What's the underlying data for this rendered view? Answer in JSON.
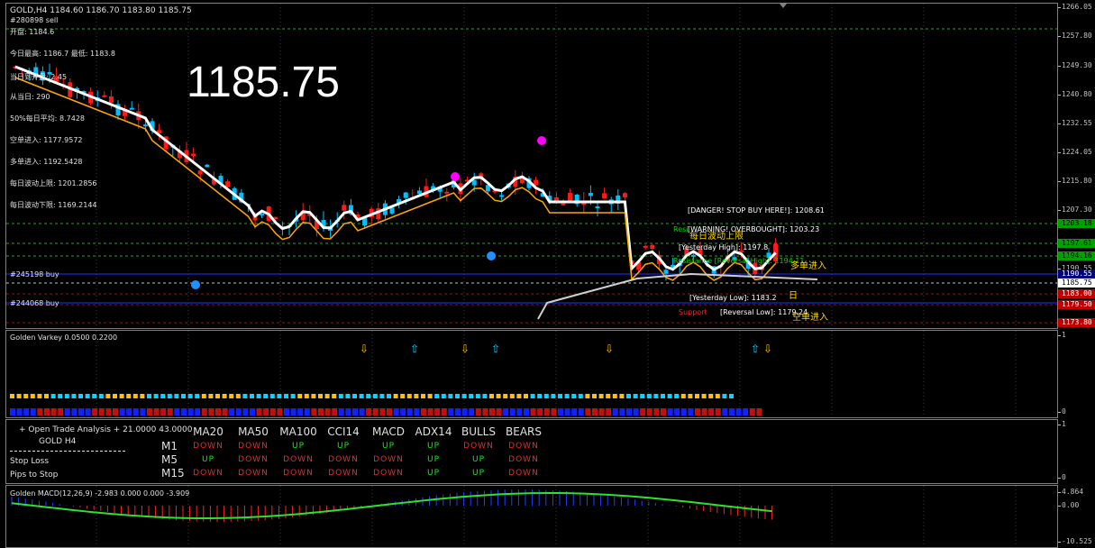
{
  "main": {
    "title": "GOLD,H4  1184.60 1186.70 1183.80 1185.75",
    "big_price": "1185.75",
    "info_lines": [
      "#280898 sell",
      "开盘: 1184.6",
      "今日最高: 1186.7  最低: 1183.8",
      "当日到开盘: 2.45",
      "从当日: 290",
      "50%每日平均: 8.7428",
      "空单进入: 1177.9572",
      "多单进入: 1192.5428",
      "每日波动上限: 1201.2856",
      "每日波动下限: 1169.2144"
    ],
    "order_labels": [
      "#245198 buy",
      "#244068 buy"
    ],
    "levels": {
      "danger": "[DANGER! STOP BUY HERE!]: 1208.61",
      "overbought": "[WARNING! OVERBOUGHT]: 1203.23",
      "upper_band": "每日波动上限",
      "yesterday_high": "[Yesterday High]: 1197.8",
      "resistance": "Resistance [Reversal High]: 1194.11",
      "long_entry": "多单进入",
      "yesterday_low": "[Yesterday Low]: 1183.2",
      "reversal_low": "[Reversal Low]: 1179.24",
      "support": "Support",
      "short_entry": "空单进入",
      "resistance_tag": "Resi",
      "mid_tag": "日"
    },
    "price_ticks": [
      "1266.05",
      "1257.80",
      "1249.30",
      "1240.80",
      "1232.55",
      "1224.05",
      "1215.80",
      "1207.30",
      "1198.80",
      "1190.55",
      "1182.05",
      "1173.80"
    ],
    "price_tags": [
      {
        "text": "1203.18",
        "bg": "#00a000",
        "fg": "#000000"
      },
      {
        "text": "1197.61",
        "bg": "#00a000",
        "fg": "#000000"
      },
      {
        "text": "1194.16",
        "bg": "#00a000",
        "fg": "#000000"
      },
      {
        "text": "1190.55",
        "bg": "#000080",
        "fg": "#ffffff"
      },
      {
        "text": "1185.75",
        "bg": "#ffffff",
        "fg": "#000000"
      },
      {
        "text": "1183.00",
        "bg": "#c00000",
        "fg": "#ffffff"
      },
      {
        "text": "1179.50",
        "bg": "#c00000",
        "fg": "#ffffff"
      },
      {
        "text": "1173.80",
        "bg": "#c00000",
        "fg": "#ffffff"
      }
    ]
  },
  "varkey": {
    "title": "Golden Varkey 0.0500 0.2200",
    "ticks": [
      "1",
      "0"
    ]
  },
  "analysis": {
    "header_left": "+ Open Trade Analysis + 21.0000 43.0000",
    "symbol": "GOLD  H4",
    "stop_loss": "Stop Loss",
    "pips_to_stop": "Pips to Stop",
    "columns": [
      "MA20",
      "MA50",
      "MA100",
      "CCI14",
      "MACD",
      "ADX14",
      "BULLS",
      "BEARS"
    ],
    "rows": [
      {
        "tf": "M1",
        "vals": [
          "DOWN",
          "DOWN",
          "UP",
          "UP",
          "UP",
          "UP",
          "DOWN",
          "DOWN"
        ]
      },
      {
        "tf": "M5",
        "vals": [
          "UP",
          "DOWN",
          "DOWN",
          "DOWN",
          "DOWN",
          "UP",
          "UP",
          "DOWN"
        ]
      },
      {
        "tf": "M15",
        "vals": [
          "DOWN",
          "DOWN",
          "DOWN",
          "DOWN",
          "DOWN",
          "UP",
          "UP",
          "DOWN"
        ]
      }
    ],
    "ticks": [
      "1",
      "0"
    ]
  },
  "macd": {
    "title": "Golden MACD(12,26,9) -2.983 0.000 0.000 -3.909",
    "ticks": [
      "4.864",
      "0.00",
      "-10.525"
    ]
  }
}
